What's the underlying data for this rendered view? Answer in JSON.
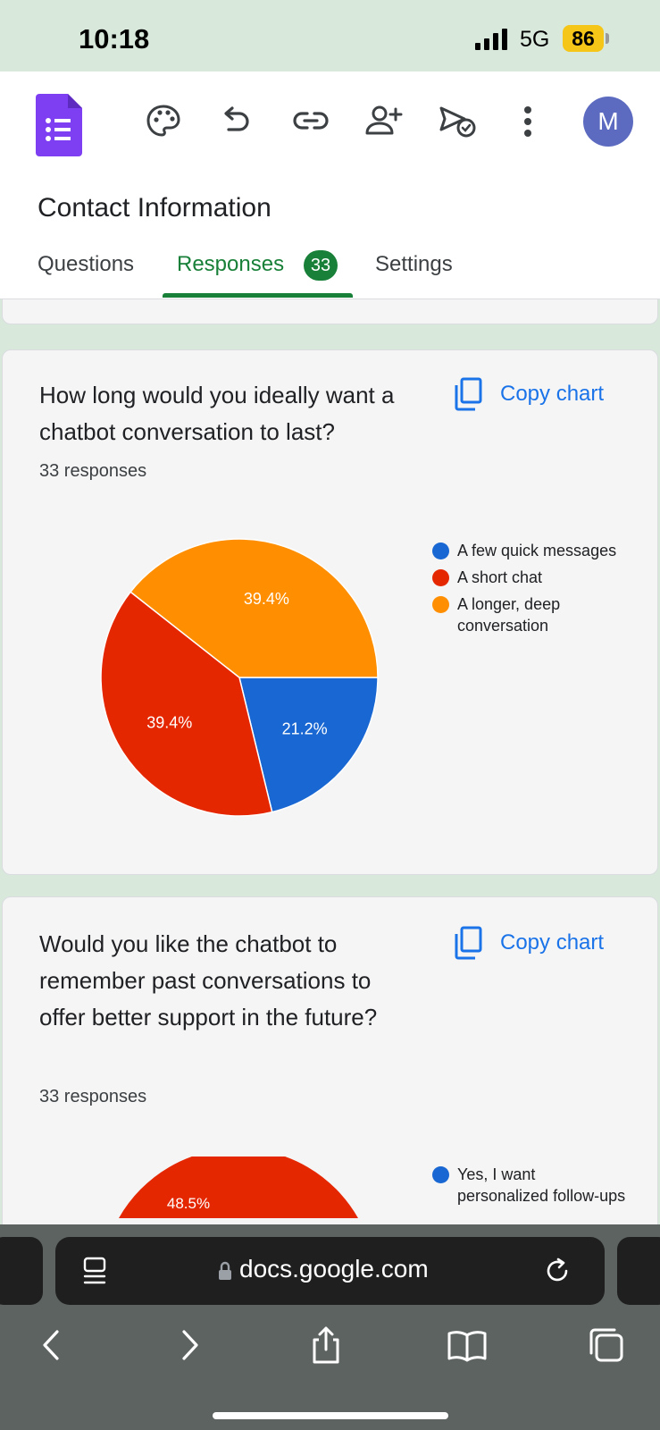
{
  "status": {
    "time": "10:18",
    "network": "5G",
    "battery": "86"
  },
  "header": {
    "form_title": "Contact Information",
    "avatar_initial": "M",
    "tabs": [
      {
        "label": "Questions"
      },
      {
        "label": "Responses",
        "badge": "33"
      },
      {
        "label": "Settings"
      }
    ]
  },
  "cards": [
    {
      "question": "How long would you ideally want a chatbot conversation to last?",
      "responses": "33 responses",
      "copy_label": "Copy chart",
      "legend": [
        {
          "label": "A few quick messages",
          "color": "#1967d2"
        },
        {
          "label": "A short chat",
          "color": "#e52700"
        },
        {
          "label": "A longer, deep conversation",
          "color": "#ff8f00"
        }
      ]
    },
    {
      "question": "Would you like the chatbot to remember past conversations to offer better support in the future?",
      "responses": "33 responses",
      "copy_label": "Copy chart",
      "legend": [
        {
          "label": "Yes, I want personalized follow-ups",
          "color": "#1967d2"
        }
      ]
    }
  ],
  "chart_data": [
    {
      "type": "pie",
      "categories": [
        "A few quick messages",
        "A short chat",
        "A longer, deep conversation"
      ],
      "values": [
        21.2,
        39.4,
        39.4
      ],
      "labels": [
        "21.2%",
        "39.4%",
        "39.4%"
      ],
      "colors": [
        "#1967d2",
        "#e52700",
        "#ff8f00"
      ],
      "legend": "right"
    },
    {
      "type": "pie",
      "categories": [
        "Yes, I want personalized follow-ups"
      ],
      "visible_labels": [
        "48.5%"
      ],
      "colors": [
        "#1967d2",
        "#e52700"
      ],
      "legend": "right"
    }
  ],
  "browser": {
    "url": "docs.google.com"
  }
}
